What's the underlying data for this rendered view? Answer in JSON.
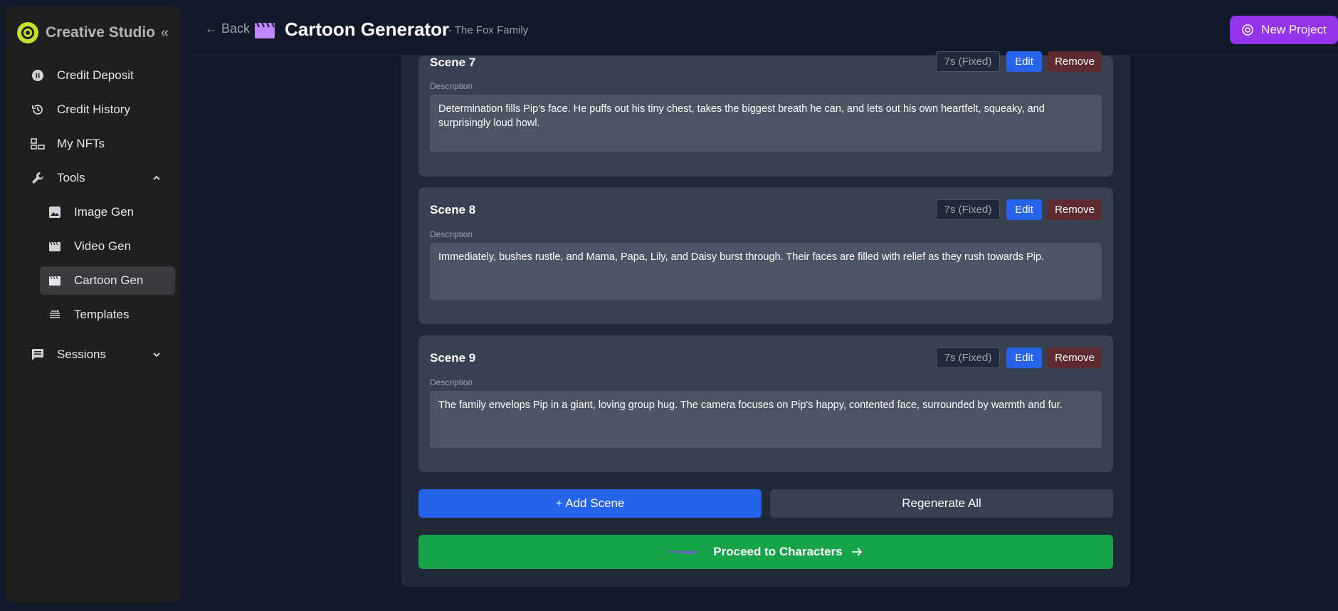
{
  "sidebar": {
    "brand": "Creative Studio",
    "items": [
      {
        "label": "Credit Deposit",
        "icon": "coin-icon"
      },
      {
        "label": "Credit History",
        "icon": "history-icon"
      },
      {
        "label": "My NFTs",
        "icon": "nft-icon"
      },
      {
        "label": "Tools",
        "icon": "wrench-icon"
      },
      {
        "label": "Sessions",
        "icon": "chat-icon"
      }
    ],
    "tools_sub": [
      {
        "label": "Image Gen",
        "icon": "image-icon"
      },
      {
        "label": "Video Gen",
        "icon": "clapper-icon"
      },
      {
        "label": "Cartoon Gen",
        "icon": "clapper-icon",
        "active": true
      },
      {
        "label": "Templates",
        "icon": "templates-icon"
      }
    ]
  },
  "header": {
    "back_label": "← Back",
    "title": "Cartoon Generator",
    "subtitle": "- The Fox Family",
    "new_project_label": "New Project"
  },
  "scenes": [
    {
      "title": "Scene 7",
      "duration": "7s (Fixed)",
      "edit_label": "Edit",
      "remove_label": "Remove",
      "desc_label": "Description",
      "description": "Determination fills Pip's face. He puffs out his tiny chest, takes the biggest breath he can, and lets out his own heartfelt, squeaky, and surprisingly loud howl."
    },
    {
      "title": "Scene 8",
      "duration": "7s (Fixed)",
      "edit_label": "Edit",
      "remove_label": "Remove",
      "desc_label": "Description",
      "description": "Immediately, bushes rustle, and Mama, Papa, Lily, and Daisy burst through. Their faces are filled with relief as they rush towards Pip."
    },
    {
      "title": "Scene 9",
      "duration": "7s (Fixed)",
      "edit_label": "Edit",
      "remove_label": "Remove",
      "desc_label": "Description",
      "description": "The family envelops Pip in a giant, loving group hug. The camera focuses on Pip's happy, contented face, surrounded by warmth and fur."
    }
  ],
  "actions": {
    "add_scene": "+ Add Scene",
    "regenerate_all": "Regenerate All",
    "proceed": "Proceed to Characters"
  },
  "colors": {
    "primary": "#2563eb",
    "success": "#16a34a",
    "purple": "#9333ea",
    "danger": "#5c2a2f"
  }
}
